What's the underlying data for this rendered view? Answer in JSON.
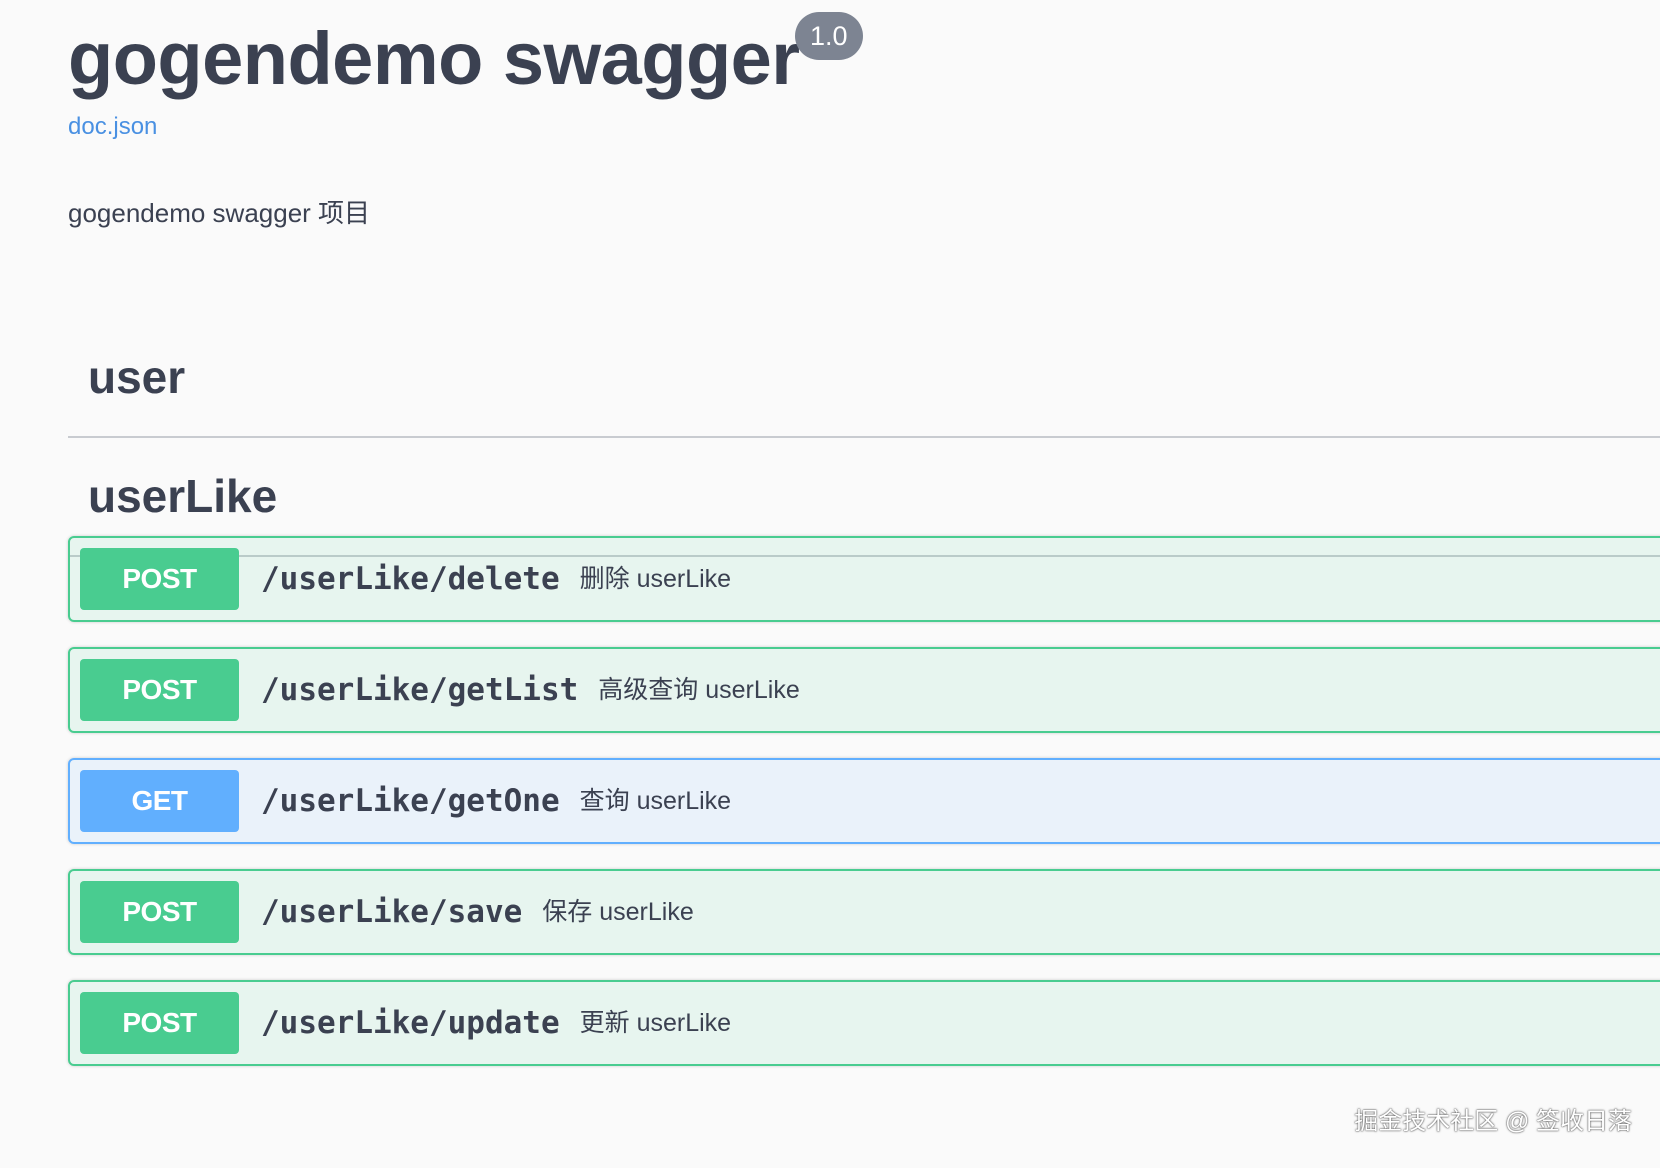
{
  "info": {
    "title": "gogendemo swagger",
    "version": "1.0",
    "doc_link": "doc.json",
    "description": "gogendemo swagger 项目"
  },
  "tags": [
    {
      "name": "user"
    },
    {
      "name": "userLike"
    }
  ],
  "operations": [
    {
      "method": "POST",
      "path": "/userLike/delete",
      "summary": "删除 userLike"
    },
    {
      "method": "POST",
      "path": "/userLike/getList",
      "summary": "高级查询 userLike"
    },
    {
      "method": "GET",
      "path": "/userLike/getOne",
      "summary": "查询 userLike"
    },
    {
      "method": "POST",
      "path": "/userLike/save",
      "summary": "保存 userLike"
    },
    {
      "method": "POST",
      "path": "/userLike/update",
      "summary": "更新 userLike"
    }
  ],
  "colors": {
    "post": "#49cc90",
    "get": "#61affe",
    "link": "#4990e2",
    "text": "#3b4151",
    "version_badge": "#7d8492"
  },
  "watermark": "掘金技术社区 @ 签收日落"
}
